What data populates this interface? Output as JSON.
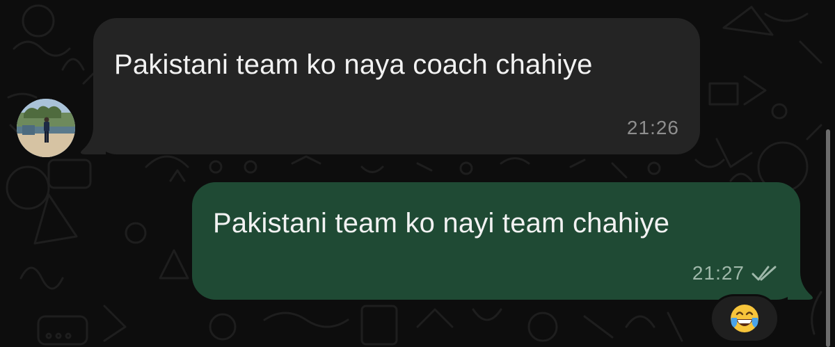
{
  "chat": {
    "messages": [
      {
        "direction": "incoming",
        "text": "Pakistani team ko naya coach chahiye",
        "time": "21:26"
      },
      {
        "direction": "outgoing",
        "text": "Pakistani team ko nayi team chahiye",
        "time": "21:27",
        "status": "read"
      }
    ],
    "reaction": {
      "emoji": "face-with-tears-of-joy",
      "icon": "laughing-emoji-icon"
    }
  },
  "colors": {
    "background": "#0d0d0d",
    "incoming_bubble": "#242424",
    "outgoing_bubble": "#1f4a34",
    "text": "#f2f2f2",
    "incoming_time": "#8e8e8e",
    "outgoing_time": "#9fb8aa"
  }
}
